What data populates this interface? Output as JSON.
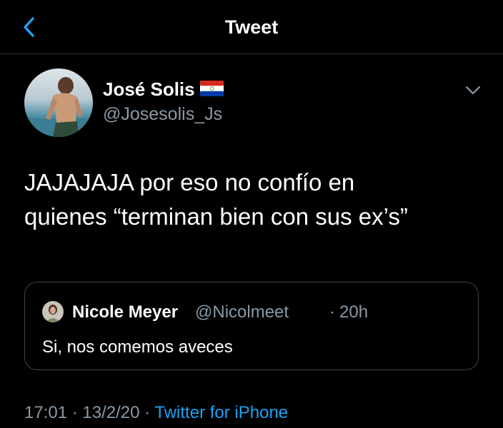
{
  "header": {
    "title": "Tweet",
    "back_icon": "chevron-left-icon"
  },
  "tweet": {
    "author": {
      "name": "José Solis",
      "handle": "@Josesolis_Js",
      "flag_icon": "paraguay-flag-icon"
    },
    "menu_icon": "chevron-down-icon",
    "text_line1": "JAJAJAJA por eso no confío en",
    "text_line2": "quienes “terminan bien con sus ex’s”",
    "quoted": {
      "name": "Nicole Meyer",
      "handle": "@Nicolmeet",
      "separator": "·",
      "time": "20h",
      "text": "Si, nos comemos aveces"
    },
    "meta": {
      "time": "17:01",
      "dot1": "·",
      "date": "13/2/20",
      "dot2": "·",
      "source": "Twitter for iPhone"
    }
  },
  "colors": {
    "background": "#000000",
    "accent": "#1da1f2",
    "secondary_text": "#8899a6",
    "border": "#2f3336"
  }
}
